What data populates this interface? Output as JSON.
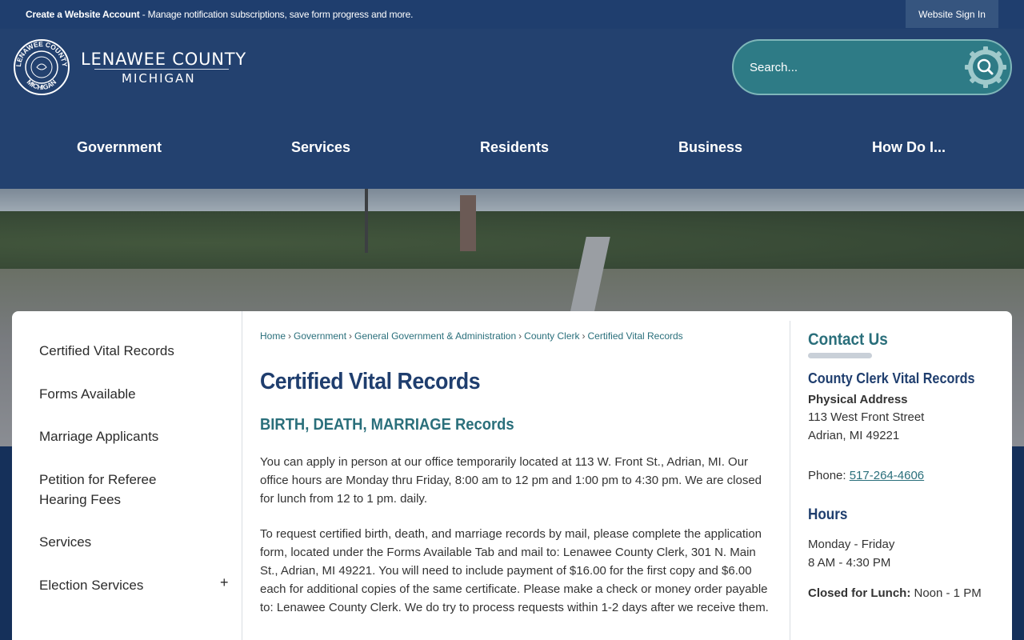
{
  "topbar": {
    "create_account_bold": "Create a Website Account",
    "create_account_rest": " - Manage notification subscriptions, save form progress and more.",
    "sign_in": "Website Sign In"
  },
  "logo": {
    "line1": "LENAWEE COUNTY",
    "line2": "MICHIGAN",
    "seal_top": "LENAWEE COUNTY",
    "seal_bottom": "MICHIGAN"
  },
  "search": {
    "placeholder": "Search..."
  },
  "nav": [
    {
      "label": "Government"
    },
    {
      "label": "Services"
    },
    {
      "label": "Residents"
    },
    {
      "label": "Business"
    },
    {
      "label": "How Do I..."
    }
  ],
  "sidebar": {
    "items": [
      {
        "label": "Certified Vital Records"
      },
      {
        "label": "Forms Available"
      },
      {
        "label": "Marriage Applicants"
      },
      {
        "label": "Petition for Referee Hearing Fees"
      },
      {
        "label": "Services"
      },
      {
        "label": "Election Services",
        "expand": "+"
      }
    ]
  },
  "breadcrumb": [
    {
      "label": "Home"
    },
    {
      "label": "Government"
    },
    {
      "label": "General Government & Administration"
    },
    {
      "label": "County Clerk"
    },
    {
      "label": "Certified Vital Records"
    }
  ],
  "breadcrumb_sep": "›",
  "main": {
    "title": "Certified Vital Records",
    "subtitle": "BIRTH, DEATH, MARRIAGE Records",
    "para1": "You can apply in person at our office temporarily located at 113 W. Front St., Adrian, MI.  Our office hours are Monday thru Friday, 8:00 am to 12 pm and 1:00 pm to 4:30 pm.  We are closed for lunch from 12 to 1 pm. daily.",
    "para2": "To request certified birth, death, and marriage records by mail, please complete the application form, located under the Forms Available Tab and mail to: Lenawee County Clerk, 301 N. Main St., Adrian, MI  49221.  You will need to include payment of $16.00 for the first copy and $6.00 each for additional copies of the same certificate.  Please make a check or money order payable to: Lenawee County Clerk.  We do try to process requests within 1-2 days after we receive them."
  },
  "contact": {
    "title": "Contact Us",
    "name": "County Clerk Vital Records",
    "address_label": "Physical Address",
    "address_line1": "113 West Front Street",
    "address_line2": "Adrian, MI 49221",
    "phone_label": "Phone: ",
    "phone": "517-264-4606",
    "hours_title": "Hours",
    "hours_days": "Monday - Friday",
    "hours_time": "8 AM - 4:30 PM",
    "lunch_label": "Closed for Lunch:",
    "lunch_time": " Noon - 1 PM"
  },
  "colors": {
    "navy": "#23416f",
    "topbar": "#1f3e6e",
    "teal": "#2a6f7b",
    "search_bg": "#2e7b86"
  }
}
